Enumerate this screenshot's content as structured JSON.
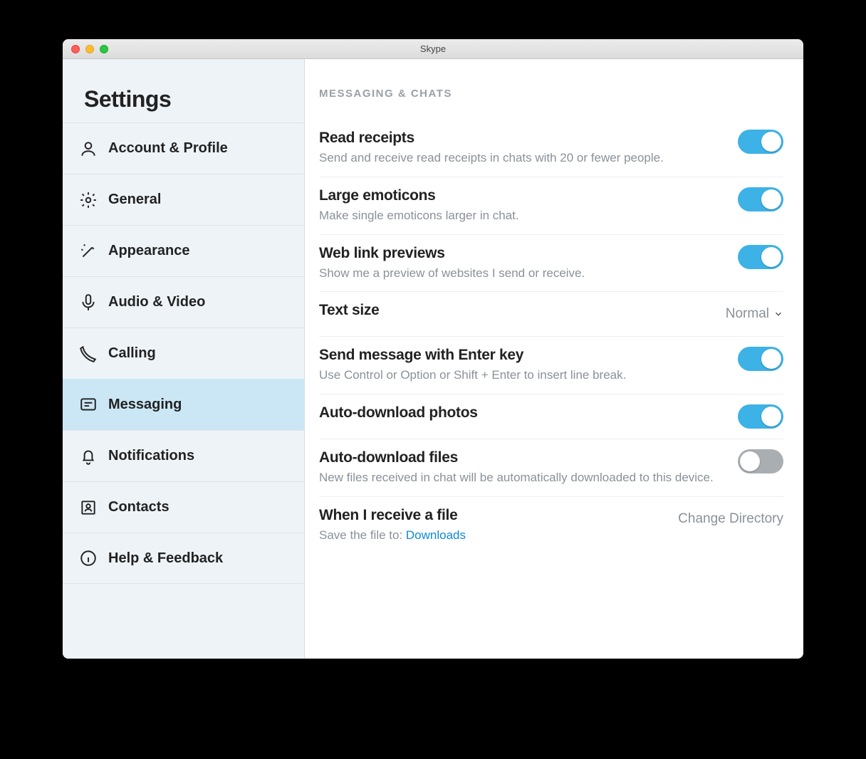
{
  "window": {
    "title": "Skype"
  },
  "sidebar": {
    "heading": "Settings",
    "items": [
      {
        "id": "account",
        "label": "Account & Profile"
      },
      {
        "id": "general",
        "label": "General"
      },
      {
        "id": "appearance",
        "label": "Appearance"
      },
      {
        "id": "audio-video",
        "label": "Audio & Video"
      },
      {
        "id": "calling",
        "label": "Calling"
      },
      {
        "id": "messaging",
        "label": "Messaging",
        "selected": true
      },
      {
        "id": "notifications",
        "label": "Notifications"
      },
      {
        "id": "contacts",
        "label": "Contacts"
      },
      {
        "id": "help-feedback",
        "label": "Help & Feedback"
      }
    ]
  },
  "section": {
    "header": "MESSAGING & CHATS",
    "readReceipts": {
      "title": "Read receipts",
      "desc": "Send and receive read receipts in chats with 20 or fewer people.",
      "on": true
    },
    "largeEmoticons": {
      "title": "Large emoticons",
      "desc": "Make single emoticons larger in chat.",
      "on": true
    },
    "webLinkPreviews": {
      "title": "Web link previews",
      "desc": "Show me a preview of websites I send or receive.",
      "on": true
    },
    "textSize": {
      "title": "Text size",
      "value": "Normal"
    },
    "sendEnter": {
      "title": "Send message with Enter key",
      "desc": "Use Control or Option or Shift + Enter to insert line break.",
      "on": true
    },
    "autoPhotos": {
      "title": "Auto-download photos",
      "on": true
    },
    "autoFiles": {
      "title": "Auto-download files",
      "desc": "New files received in chat will be automatically downloaded to this device.",
      "on": false
    },
    "receiveFile": {
      "title": "When I receive a file",
      "descPrefix": "Save the file to: ",
      "descLink": "Downloads",
      "action": "Change Directory"
    }
  }
}
